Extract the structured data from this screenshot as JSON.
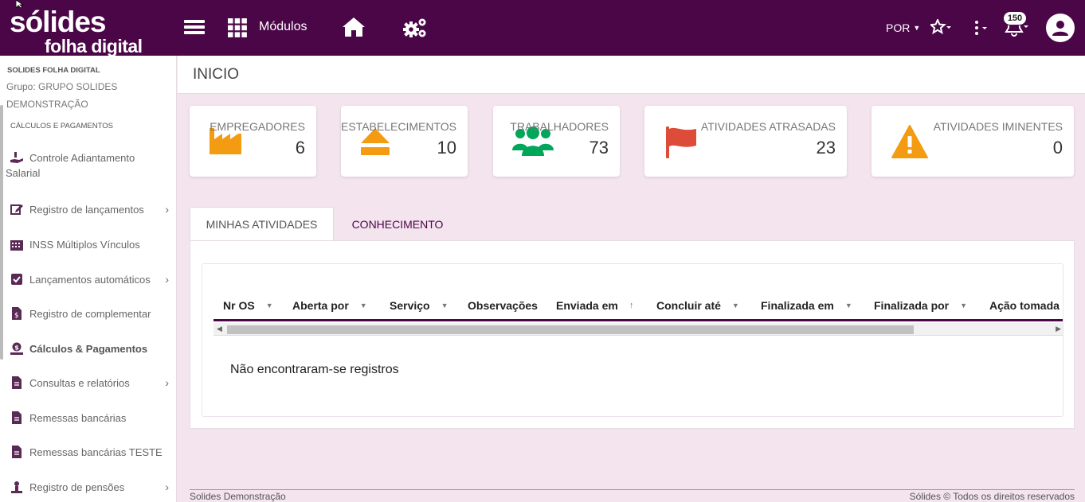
{
  "brand": {
    "name": "sólides",
    "sub": "folha digital"
  },
  "topbar": {
    "modules_label": "Módulos",
    "language": "POR",
    "notifications_count": "150",
    "background": "#4b0648"
  },
  "sidebar": {
    "company": "SOLIDES FOLHA DIGITAL",
    "group": "Grupo: GRUPO SOLIDES DEMONSTRAÇÃO",
    "section": "CÁLCULOS E PAGAMENTOS",
    "items": [
      {
        "label": "Controle Adiantamento",
        "icon": "hand-money-icon"
      },
      {
        "label": "Registro de lançamentos",
        "icon": "edit-icon"
      },
      {
        "label": "INSS Múltiplos Vínculos",
        "icon": "building-icon"
      },
      {
        "label": "Lançamentos automáticos",
        "icon": "checkbox-icon"
      },
      {
        "label": "Registro de complementar",
        "icon": "document-dollar-icon"
      },
      {
        "label": "Cálculos & Pagamentos",
        "icon": "coin-hand-icon"
      },
      {
        "label": "Consultas e relatórios",
        "icon": "document-icon"
      },
      {
        "label": "Remessas bancárias",
        "icon": "document-icon"
      },
      {
        "label": "Remessas bancárias TESTE",
        "icon": "document-icon"
      },
      {
        "label": "Registro de pensões",
        "icon": "person-icon"
      }
    ],
    "item0_continuation": "Salarial"
  },
  "page": {
    "title": "INICIO"
  },
  "cards": [
    {
      "label": "EMPREGADORES",
      "value": "6",
      "icon": "factory-icon",
      "color": "#f39c12"
    },
    {
      "label": "ESTABELECIMENTOS",
      "value": "10",
      "icon": "eject-icon",
      "color": "#f39c12"
    },
    {
      "label": "TRABALHADORES",
      "value": "73",
      "icon": "users-icon",
      "color": "#00a65a"
    },
    {
      "label": "ATIVIDADES ATRASADAS",
      "value": "23",
      "icon": "flag-icon",
      "color": "#dd4b39"
    },
    {
      "label": "ATIVIDADES IMINENTES",
      "value": "0",
      "icon": "warning-icon",
      "color": "#f39c12"
    }
  ],
  "tabs": [
    {
      "label": "MINHAS ATIVIDADES"
    },
    {
      "label": "CONHECIMENTO"
    }
  ],
  "table": {
    "columns": [
      "Nr OS",
      "Aberta por",
      "Serviço",
      "Observações",
      "Enviada em",
      "Concluir até",
      "Finalizada em",
      "Finalizada por",
      "Ação tomada"
    ],
    "empty_message": "Não encontraram-se registros"
  },
  "footer": {
    "left": "Solides Demonstração",
    "right": "Sólides © Todos os direitos reservados"
  }
}
